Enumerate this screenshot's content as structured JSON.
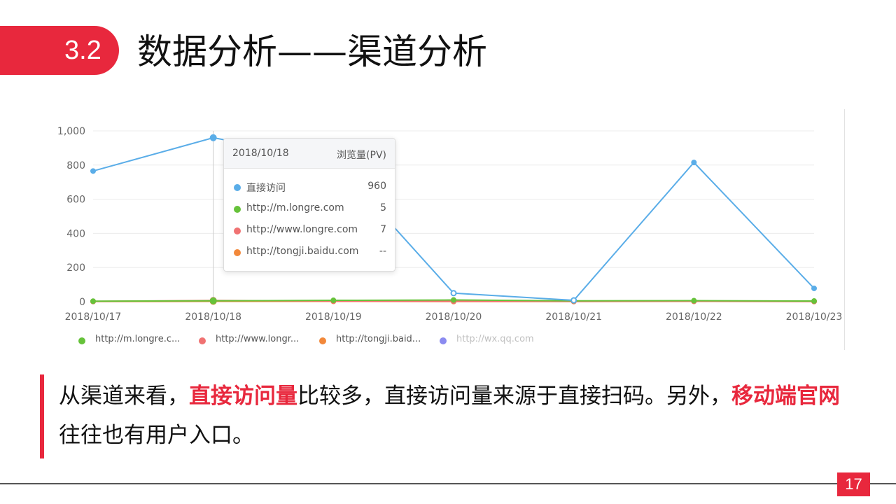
{
  "header": {
    "section_number": "3.2",
    "title": "数据分析——渠道分析"
  },
  "chart_data": {
    "type": "line",
    "categories": [
      "2018/10/17",
      "2018/10/18",
      "2018/10/19",
      "2018/10/20",
      "2018/10/21",
      "2018/10/22",
      "2018/10/23"
    ],
    "ylim": [
      0,
      1000
    ],
    "yticks": [
      "0",
      "200",
      "400",
      "600",
      "800",
      "1,000"
    ],
    "grid": true,
    "legend_position": "bottom-left",
    "series": [
      {
        "name": "直接访问",
        "color": "#5aade8",
        "values": [
          765,
          960,
          830,
          50,
          8,
          815,
          78
        ],
        "in_legend": false
      },
      {
        "name": "http://m.longre.com",
        "legend_label": "http://m.longre.c...",
        "color": "#66c23a",
        "values": [
          3,
          5,
          8,
          10,
          5,
          6,
          4
        ],
        "in_legend": true
      },
      {
        "name": "http://www.longre.com",
        "legend_label": "http://www.longr...",
        "color": "#f07272",
        "values": [
          2,
          7,
          4,
          3,
          2,
          3,
          2
        ],
        "in_legend": true
      },
      {
        "name": "http://tongji.baidu.com",
        "legend_label": "http://tongji.baid...",
        "color": "#f2883a",
        "values": [
          1,
          2,
          2,
          1,
          1,
          2,
          1
        ],
        "in_legend": true
      },
      {
        "name": "http://wx.qq.com",
        "legend_label": "http://wx.qq.com",
        "color": "#8b8bf0",
        "values": [],
        "in_legend": true,
        "disabled": true
      }
    ],
    "tooltip": {
      "date": "2018/10/18",
      "metric": "浏览量(PV)",
      "rows": [
        {
          "name": "直接访问",
          "value": "960",
          "color": "#5aade8"
        },
        {
          "name": "http://m.longre.com",
          "value": "5",
          "color": "#66c23a"
        },
        {
          "name": "http://www.longre.com",
          "value": "7",
          "color": "#f07272"
        },
        {
          "name": "http://tongji.baidu.com",
          "value": "--",
          "color": "#f2883a"
        }
      ]
    }
  },
  "body": {
    "p1": "从渠道来看，",
    "h1": "直接访问量",
    "p2": "比较多，直接访问量来源于直接扫码。另外，",
    "h2": "移动端官网",
    "p3": "往往也有用户入口。"
  },
  "footer": {
    "page_number": "17"
  }
}
